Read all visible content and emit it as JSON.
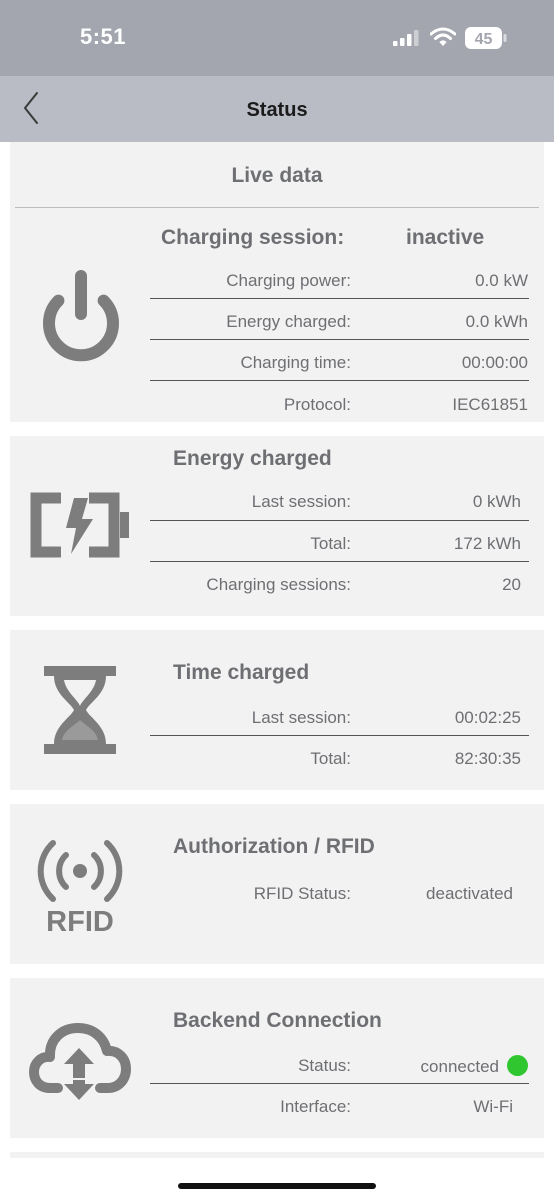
{
  "status_bar": {
    "time": "5:51",
    "battery": "45"
  },
  "nav": {
    "title": "Status",
    "back_icon": "chevron-left-icon"
  },
  "live_data": {
    "title": "Live data",
    "session_label": "Charging session:",
    "session_value": "inactive",
    "rows": [
      {
        "label": "Charging power:",
        "value": "0.0 kW"
      },
      {
        "label": "Energy charged:",
        "value": "0.0 kWh"
      },
      {
        "label": "Charging time:",
        "value": "00:00:00"
      },
      {
        "label": "Protocol:",
        "value": "IEC61851"
      }
    ],
    "icon": "power-icon"
  },
  "energy": {
    "title": "Energy charged",
    "rows": [
      {
        "label": "Last session:",
        "value": "0 kWh"
      },
      {
        "label": "Total:",
        "value": "172 kWh"
      },
      {
        "label": "Charging sessions:",
        "value": "20"
      }
    ],
    "icon": "battery-charging-icon"
  },
  "time": {
    "title": "Time charged",
    "rows": [
      {
        "label": "Last session:",
        "value": "00:02:25"
      },
      {
        "label": "Total:",
        "value": "82:30:35"
      }
    ],
    "icon": "hourglass-icon"
  },
  "rfid": {
    "title": "Authorization / RFID",
    "rows": [
      {
        "label": "RFID Status:",
        "value": "deactivated"
      }
    ],
    "icon_text": "RFID",
    "icon": "rfid-icon"
  },
  "backend": {
    "title": "Backend Connection",
    "rows": [
      {
        "label": "Status:",
        "value": "connected"
      },
      {
        "label": "Interface:",
        "value": "Wi-Fi"
      }
    ],
    "status_color": "#2fc62f",
    "icon": "cloud-sync-icon"
  },
  "colors": {
    "statusbar": "#a3a6ae",
    "navbar": "#b9bcc4",
    "card": "#f2f2f2",
    "text": "#6e6f73"
  }
}
